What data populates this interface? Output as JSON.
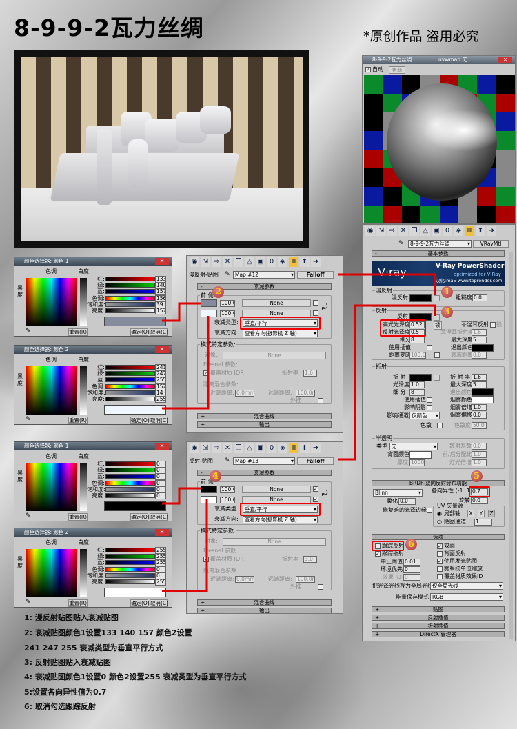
{
  "title": "8-9-9-2瓦力丝绸",
  "copyright": "*原创作品 盗用必究",
  "material_preview": {
    "title": "8-9-9-2瓦力丝绸",
    "map": "uvwmap:无",
    "auto": "自动",
    "update": "更新"
  },
  "color_pickers": [
    {
      "title": "颜色选择器: 颜色 1",
      "hue": "色调",
      "white": "白度",
      "black": "黑度",
      "labels": [
        "红:",
        "绿:",
        "蓝:",
        "色调:",
        "饱和度:",
        "亮度:"
      ],
      "values": [
        "133",
        "140",
        "157",
        "156",
        "39",
        "157"
      ],
      "reset": "重置(R)",
      "ok": "确定(O)",
      "cancel": "取消(C)",
      "color": "#858c9d"
    },
    {
      "title": "颜色选择器: 颜色 2",
      "hue": "色调",
      "white": "白度",
      "black": "黑度",
      "labels": [
        "红:",
        "绿:",
        "蓝:",
        "色调:",
        "饱和度:",
        "亮度:"
      ],
      "values": [
        "241",
        "247",
        "255",
        "152",
        "14",
        "255"
      ],
      "reset": "重置(R)",
      "ok": "确定(O)",
      "cancel": "取消(C)",
      "color": "#f1f7ff"
    },
    {
      "title": "颜色选择器: 颜色 1",
      "hue": "色调",
      "white": "白度",
      "black": "黑度",
      "labels": [
        "红:",
        "绿:",
        "蓝:",
        "色调:",
        "饱和度:",
        "亮度:"
      ],
      "values": [
        "0",
        "0",
        "0",
        "0",
        "0",
        "0"
      ],
      "reset": "重置(R)",
      "ok": "确定(O)",
      "cancel": "取消(C)",
      "color": "#000000"
    },
    {
      "title": "颜色选择器: 颜色 2",
      "hue": "色调",
      "white": "白度",
      "black": "黑度",
      "labels": [
        "红:",
        "绿:",
        "蓝:",
        "色调:",
        "饱和度:",
        "亮度:"
      ],
      "values": [
        "255",
        "255",
        "255",
        "0",
        "0",
        "255"
      ],
      "reset": "重置(R)",
      "ok": "确定(O)",
      "cancel": "取消(C)",
      "color": "#ffffff"
    }
  ],
  "falloff_panels": [
    {
      "slot": "漫反射-贴图",
      "map": "Map #12",
      "type": "Falloff",
      "rollout": "衰减参数",
      "group": "前:侧",
      "amount1": "100.0",
      "amount2": "100.0",
      "none": "None",
      "color1": "#858c9d",
      "color2": "#f1f7ff",
      "check1": "",
      "check2": "",
      "type_label": "衰减类型:",
      "type_value": "垂直/平行",
      "dir_label": "衰减方向:",
      "dir_value": "查看方向(摄影机 Z 轴)",
      "mode_group": "模式特定参数:",
      "object": "对象:",
      "object_value": "None",
      "fresnel": "Fresnel 参数:",
      "override": "覆盖材质 IOR",
      "ior_label": "折射率",
      "ior": "1.6",
      "distance": "距离混合参数:",
      "near": "近端距离:",
      "near_value": "0.0mm",
      "far": "远端距离:",
      "far_value": "100.0mm",
      "extrapolate": "外推",
      "mix_curve": "混合曲线",
      "output": "输出"
    },
    {
      "slot": "反射-贴图",
      "map": "Map #13",
      "type": "Falloff",
      "rollout": "衰减参数",
      "group": "前:侧",
      "amount1": "100.0",
      "amount2": "100.0",
      "none": "None",
      "color1": "#000000",
      "color2": "#ffffff",
      "check1": "✓",
      "check2": "✓",
      "type_label": "衰减类型:",
      "type_value": "垂直/平行",
      "dir_label": "衰减方向:",
      "dir_value": "查看方向(摄影机 Z 轴)",
      "mode_group": "模式特定参数:",
      "object": "对象:",
      "object_value": "None",
      "fresnel": "Fresnel 参数:",
      "override": "覆盖材质 IOR",
      "ior_label": "折射率",
      "ior": "3.0",
      "distance": "距离混合参数:",
      "near": "近端距离:",
      "near_value": "0.0mm",
      "far": "远端距离:",
      "far_value": "100.0mm",
      "extrapolate": "外推",
      "mix_curve": "混合曲线",
      "output": "输出"
    }
  ],
  "vray": {
    "material_name": "8-9-9-2瓦力丝绸",
    "material_type": "VRayMtl",
    "basic": "基本参数",
    "banner_logo": "V·ray",
    "banner_title": "V-Ray PowerShader",
    "banner_sub": "optimized for V-Ray",
    "banner_url": "汉化:ma5 www.toprender.com",
    "diffuse": {
      "group": "漫反射",
      "label": "漫反射",
      "roughness_label": "粗糙度",
      "roughness": "0.0"
    },
    "reflection": {
      "group": "反射",
      "label": "反射",
      "hilight_label": "高光光泽度",
      "hilight": "0.52",
      "lock": "锁",
      "gloss_label": "反射光泽度",
      "gloss": "0.5",
      "subdivs_label": "细分",
      "subdivs": "8",
      "interp": "使用插值",
      "dim_label": "距离变暗",
      "dim": "100.0m",
      "fresnel": "菲涅耳反射",
      "fresnel_lock": "锁",
      "fresnel_ior_label": "菲涅耳折射率",
      "fresnel_ior": "1.6",
      "max_depth_label": "最大深度",
      "max_depth": "5",
      "exit_label": "退出颜色",
      "falloff_label": "衰减距离",
      "falloff": "0.0"
    },
    "refraction": {
      "group": "折射",
      "label": "折 射",
      "gloss_label": "光泽度",
      "gloss": "1.0",
      "subdivs_label": "细 分",
      "subdivs": "8",
      "interp": "使用插值",
      "shadows": "影响阴影",
      "channels_label": "影响通道",
      "channels": "仅颜色",
      "dispersion": "色散",
      "ior_label": "折 射 率",
      "ior": "1.6",
      "max_depth_label": "最大深度",
      "max_depth": "5",
      "exit_label": "退出颜色",
      "fog_color": "烟雾颜色",
      "fog_mult_label": "烟雾倍增",
      "fog_mult": "1.0",
      "fog_bias_label": "烟雾偏移",
      "fog_bias": "0.0",
      "abbe_label": "色散度",
      "abbe": "50.0"
    },
    "translucency": {
      "group": "半透明",
      "type_label": "类型",
      "type": "无",
      "back_label": "背面颜色",
      "thick_label": "厚度",
      "thick": "1000.0",
      "scatter_label": "散射系数",
      "scatter": "0.0",
      "fb_label": "前/后分配比",
      "fb": "1.0",
      "light_label": "灯光倍增",
      "light": "1.0"
    },
    "brdf": {
      "header": "BRDF-双向反射分布功能",
      "type": "Blinn",
      "aniso_label": "各向异性 (-1..1)",
      "aniso": "0.7",
      "rot_label": "旋转",
      "rot": "0.0",
      "soften_label": "柔化",
      "soften": "0.0",
      "fix_dark": "修复暗的光泽边缘",
      "uv_group": "UV 矢量源",
      "local_axis": "局部轴",
      "x": "X",
      "y": "Y",
      "z": "Z",
      "map_channel": "贴图通道",
      "channel": "1"
    },
    "options": {
      "header": "选项",
      "trace_refl": "跟踪反射",
      "trace_refr": "跟踪折射",
      "cutoff_label": "中止阈值",
      "cutoff": "0.01",
      "env_label": "环境优先",
      "env": "0",
      "effect_label": "效果 ID",
      "effect": "0",
      "double_sided": "双面",
      "back_refl": "背面反射",
      "use_irr": "使用发光贴图",
      "fog_units": "雾系统单位缩放",
      "override_id": "覆盖材质效果ID",
      "glossy_label": "把光泽光线视为全局光线:",
      "glossy": "仅全局光线",
      "energy_label": "能量保存模式",
      "energy": "RGB"
    },
    "rollouts": [
      "贴图",
      "反射插值",
      "折射插值",
      "DirectX 管理器"
    ]
  },
  "markers": [
    "1",
    "2",
    "3",
    "4",
    "5",
    "6"
  ],
  "steps": [
    "1: 漫反射贴图贴入衰减贴图",
    "2: 衰减贴图颜色1设置133 140 157 颜色2设置",
    "241 247 255 衰减类型为垂直平行方式",
    "3: 反射贴图贴入衰减贴图",
    "4: 衰减贴图颜色1设置0 颜色2设置255 衰减类型为垂直平行方式",
    "5:设置各向异性值为0.7",
    "6: 取消勾选跟踪反射"
  ],
  "colors": {
    "accent_red": "#e00000",
    "marker_digit": "#ffd400"
  }
}
